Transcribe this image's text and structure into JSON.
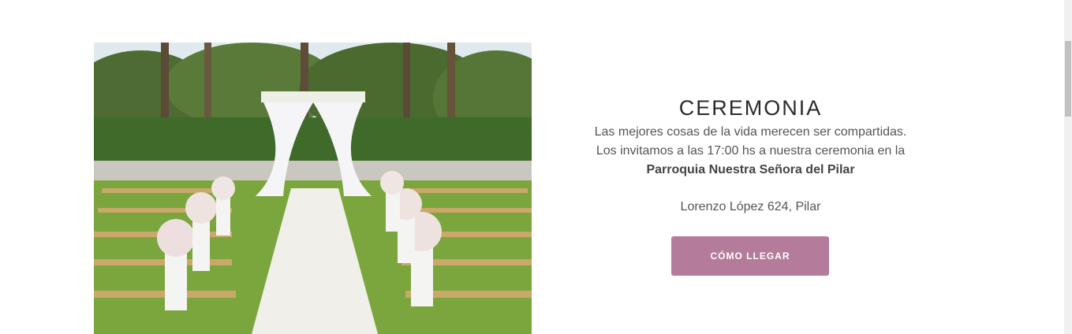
{
  "ceremony": {
    "title": "CEREMONIA",
    "line1": "Las mejores cosas de la vida merecen ser compartidas.",
    "line2": "Los invitamos a las 17:00 hs a nuestra ceremonia en la",
    "place": "Parroquia Nuestra Señora del Pilar",
    "address": "Lorenzo López 624, Pilar",
    "button_label": "CÓMO LLEGAR",
    "button_color": "#b47c9a"
  },
  "image": {
    "subject": "outdoor wedding ceremony arch with white chairs and flower aisle"
  }
}
